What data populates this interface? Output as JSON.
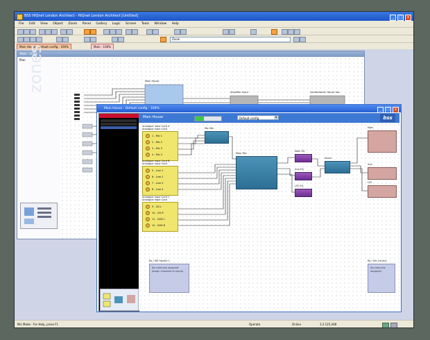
{
  "app": {
    "title": "BSS HiQnet London Architect - HiQnet London Architect [Untitled]",
    "menus": [
      "File",
      "Edit",
      "View",
      "Object",
      "Zoom",
      "Panel",
      "Gallery",
      "Logic",
      "Screen",
      "Tools",
      "Window",
      "Help"
    ],
    "zoom_combo": "Zoom",
    "doc_tabs": [
      "Main House - Default config - 100%",
      "Main - 100%"
    ]
  },
  "zones_window": {
    "title": "Main - 100%",
    "plan_label": "Plan",
    "watermark": "zones",
    "blocks": [
      {
        "label": "Main House"
      },
      {
        "label": "Amplifier Input"
      },
      {
        "label": "Southeastern House Vox"
      }
    ]
  },
  "main_window": {
    "title": "Main House - Default config - 100%",
    "header_name": "Main House",
    "meter_level": 0.34,
    "config_value": "Default config",
    "logo": "bss",
    "input_cards": [
      {
        "title": "Analogue Input Card A",
        "subtitle": "Analogue Input Card",
        "rows": [
          "1 - Mic 1",
          "2 - Mic 2",
          "3 - Mic 3",
          "4 - Mic 4"
        ]
      },
      {
        "title": "Analogue Input Card B",
        "subtitle": "Analogue Input Card",
        "rows": [
          "5 - Line 1",
          "6 - Line 2",
          "7 - Line 3",
          "8 - Line 4"
        ]
      },
      {
        "title": "Analogue Input Card C",
        "subtitle": "Analogue Input Card",
        "rows": [
          "9 - CD L",
          "10 - CD R",
          "11 - DVD L",
          "12 - DVD R"
        ]
      }
    ],
    "mic_mix_label": "Mic Mix",
    "main_mix_label": "Main Mix",
    "eq_labels": [
      "Main EQ",
      "Sub EQ",
      "LFE EQ"
    ],
    "xover_label": "Xover",
    "outputs": [
      "Main",
      "Sub",
      "LFE"
    ],
    "notes": [
      {
        "title": "Ro / ME Handle 1",
        "body": "No channels assigned. Assign channels to inputs."
      },
      {
        "title": "Ro / Mic Control",
        "body": "No channels assigned."
      }
    ]
  },
  "status": {
    "left": "Mic Mode - For Help, press F1",
    "mode": "Operate",
    "state": "Online",
    "values": "3,3  125,448"
  }
}
